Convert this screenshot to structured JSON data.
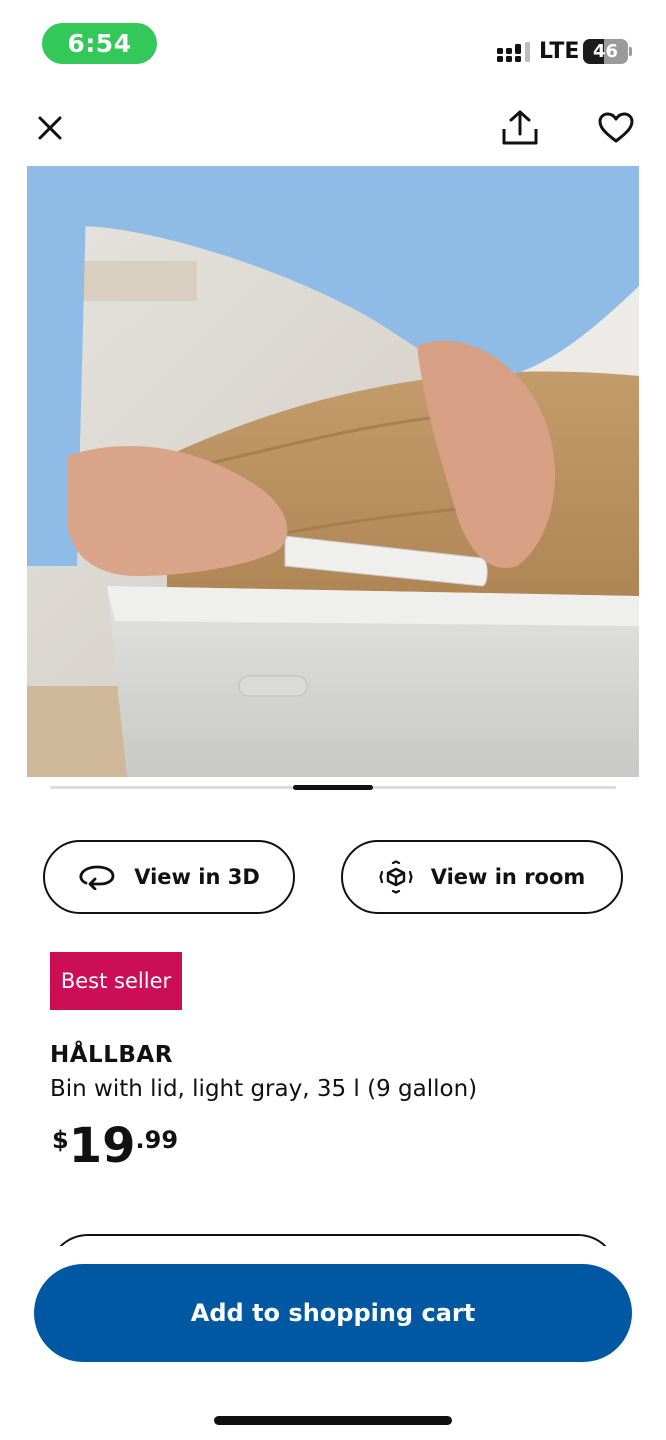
{
  "status_bar": {
    "time": "6:54",
    "network": "LTE",
    "battery_level": "46",
    "battery_fraction": 0.46,
    "time_pill_color": "#34c759"
  },
  "top_actions": {
    "close_icon": "close-icon",
    "share_icon": "share-icon",
    "favorite_icon": "heart-icon"
  },
  "gallery": {
    "image_subject": "hands placing paper bag in light gray bin",
    "carousel_position": 0.5
  },
  "actions": {
    "view_3d_label": "View in 3D",
    "view_3d_icon": "rotate-3d-icon",
    "view_room_label": "View in room",
    "view_room_icon": "ar-cube-icon"
  },
  "product": {
    "badge": "Best seller",
    "badge_color": "#cc0e54",
    "name": "HÅLLBAR",
    "description": "Bin with lid, light gray, 35 l (9 gallon)",
    "price_currency": "$",
    "price_whole": "19",
    "price_cents": ".99"
  },
  "cart": {
    "label": "Add to shopping cart",
    "color": "#0058a3"
  }
}
